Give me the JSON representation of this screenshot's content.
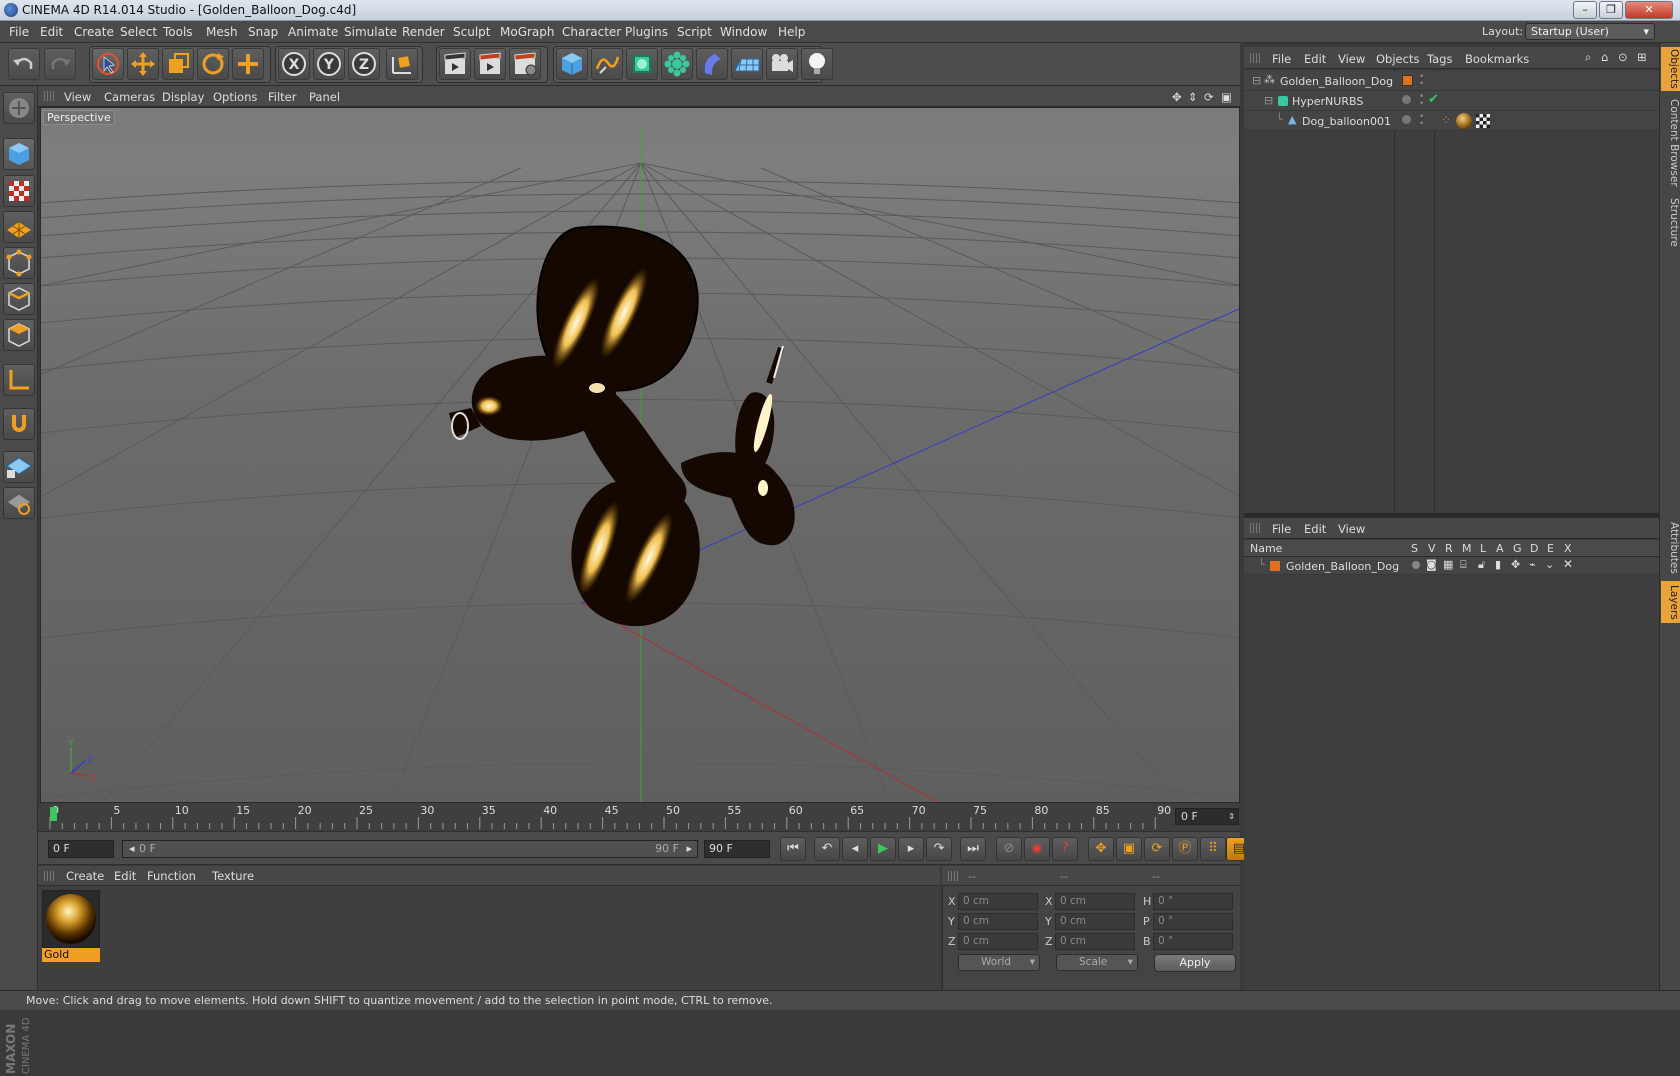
{
  "window": {
    "title": "CINEMA 4D R14.014 Studio - [Golden_Balloon_Dog.c4d]",
    "minimize": "–",
    "maximize": "❐",
    "close": "✕"
  },
  "menu": [
    "File",
    "Edit",
    "Create",
    "Select",
    "Tools",
    "Mesh",
    "Snap",
    "Animate",
    "Simulate",
    "Render",
    "Sculpt",
    "MoGraph",
    "Character",
    "Plugins",
    "Script",
    "Window",
    "Help"
  ],
  "layout": {
    "label": "Layout:",
    "value": "Startup (User)"
  },
  "viewport": {
    "menu": [
      "View",
      "Cameras",
      "Display",
      "Options",
      "Filter",
      "Panel"
    ],
    "camera_label": "Perspective",
    "axis": {
      "y": "Y",
      "x": "X",
      "z": "Z"
    }
  },
  "timeline": {
    "ticks": [
      "0",
      "5",
      "10",
      "15",
      "20",
      "25",
      "30",
      "35",
      "40",
      "45",
      "50",
      "55",
      "60",
      "65",
      "70",
      "75",
      "80",
      "85",
      "90"
    ],
    "current_frame": "0 F"
  },
  "transport": {
    "start": "0 F",
    "range_start": "0 F",
    "range_end": "90 F",
    "end": "90 F"
  },
  "material_manager": {
    "menu": [
      "Create",
      "Edit",
      "Function",
      "Texture"
    ],
    "materials": [
      {
        "name": "Gold"
      }
    ]
  },
  "coordinates": {
    "headers": [
      "--",
      "--",
      "--"
    ],
    "rows": [
      {
        "a": "X",
        "pos": "0 cm",
        "b": "X",
        "size": "0 cm",
        "c": "H",
        "rot": "0 °"
      },
      {
        "a": "Y",
        "pos": "0 cm",
        "b": "Y",
        "size": "0 cm",
        "c": "P",
        "rot": "0 °"
      },
      {
        "a": "Z",
        "pos": "0 cm",
        "b": "Z",
        "size": "0 cm",
        "c": "B",
        "rot": "0 °"
      }
    ],
    "space": "World",
    "mode": "Scale",
    "apply": "Apply"
  },
  "object_manager": {
    "menu": [
      "File",
      "Edit",
      "View",
      "Objects",
      "Tags",
      "Bookmarks"
    ],
    "objects": [
      {
        "name": "Golden_Balloon_Dog",
        "color": "#e07020"
      },
      {
        "name": "HyperNURBS",
        "color": "#3ac8a0"
      },
      {
        "name": "Dog_balloon001",
        "color": "#7fb4e8"
      }
    ]
  },
  "layer_manager": {
    "menu": [
      "File",
      "Edit",
      "View"
    ],
    "columns": [
      "Name",
      "S",
      "V",
      "R",
      "M",
      "L",
      "A",
      "G",
      "D",
      "E",
      "X"
    ],
    "layers": [
      {
        "name": "Golden_Balloon_Dog",
        "color": "#e07020"
      }
    ]
  },
  "side_tabs": [
    "Objects",
    "Content Browser",
    "Structure",
    "Attributes",
    "Layers"
  ],
  "status": "Move: Click and drag to move elements. Hold down SHIFT to quantize movement / add to the selection in point mode, CTRL to remove.",
  "logo": {
    "line1": "MAXON",
    "line2": "CINEMA 4D"
  },
  "colors": {
    "accent": "#f0a020",
    "selected_tab": "#e8a33a",
    "x_axis": "#c03030",
    "y_axis": "#30a030",
    "z_axis": "#3040c0"
  }
}
